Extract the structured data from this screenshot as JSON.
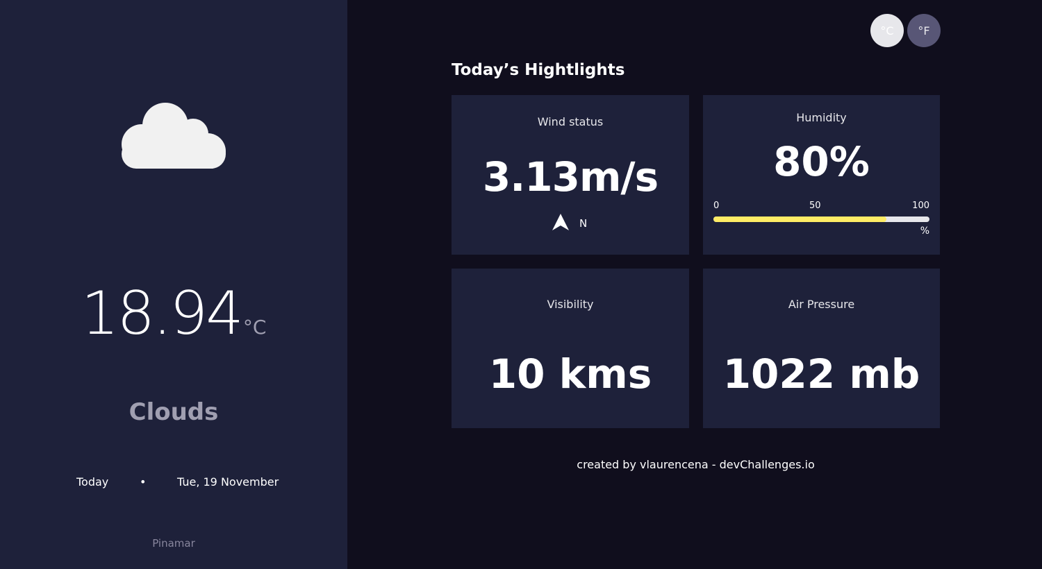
{
  "sidebar": {
    "weather_icon": "cloud-icon",
    "temperature": "18.94",
    "temperature_unit": "°C",
    "condition": "Clouds",
    "date_today": "Today",
    "date_separator": "•",
    "date_full": "Tue, 19 November",
    "location": "Pinamar"
  },
  "units": {
    "celsius_label": "°C",
    "fahrenheit_label": "°F"
  },
  "highlights": {
    "title": "Today’s Hightlights",
    "wind": {
      "title": "Wind status",
      "value": "3.13m/s",
      "direction_icon": "navigation-arrow-icon",
      "direction": "N"
    },
    "humidity": {
      "title": "Humidity",
      "value": "80%",
      "percent": 80,
      "scale_min": "0",
      "scale_mid": "50",
      "scale_max": "100",
      "unit": "%"
    },
    "visibility": {
      "title": "Visibility",
      "value": "10 kms"
    },
    "pressure": {
      "title": "Air Pressure",
      "value": "1022 mb"
    }
  },
  "footer": {
    "text": "created by vlaurencena - devChallenges.io"
  },
  "colors": {
    "sidebar_bg": "#1e213a",
    "main_bg": "#100e1d",
    "card_bg": "#1e213a",
    "progress_fill": "#ffec65",
    "progress_track": "#e7e7eb",
    "muted_text": "#a09fb1"
  }
}
